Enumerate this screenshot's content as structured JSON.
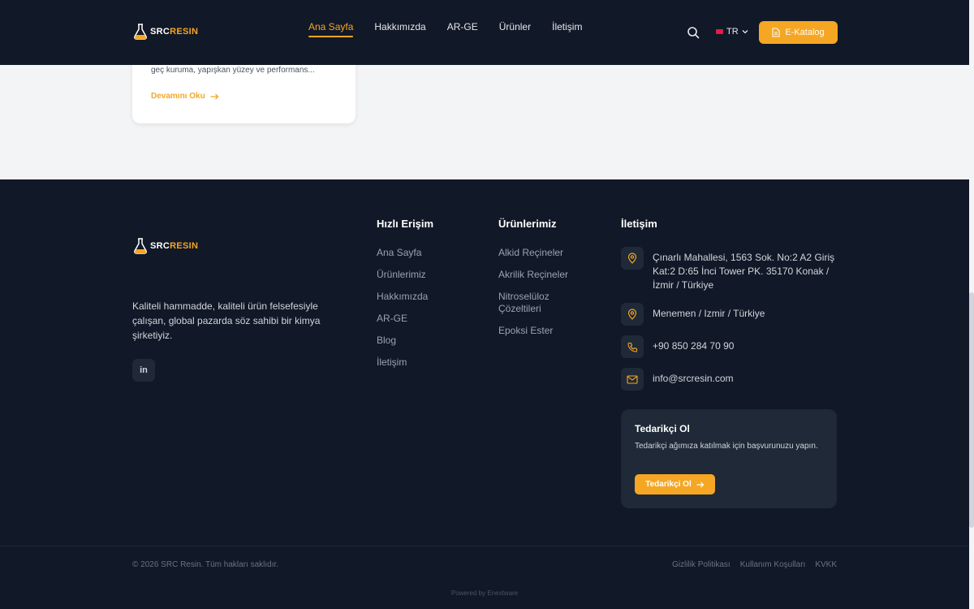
{
  "brand": {
    "name_part1": "SRC",
    "name_part2": "RESIN",
    "accent_color": "#f5a623",
    "background": "#111827"
  },
  "header": {
    "nav": [
      {
        "label": "Ana Sayfa",
        "active": true
      },
      {
        "label": "Hakkımızda"
      },
      {
        "label": "AR-GE"
      },
      {
        "label": "Ürünler"
      },
      {
        "label": "İletişim"
      }
    ],
    "language": "TR",
    "catalog_label": "E-Katalog"
  },
  "blog_card": {
    "excerpt": "geç kuruma, yapışkan yüzey ve performans...",
    "read_more": "Devamını Oku"
  },
  "footer": {
    "about": "Kaliteli hammadde, kaliteli ürün felsefesiyle çalışan, global pazarda söz sahibi bir kimya şirketiyiz.",
    "social_label": "in",
    "quick_access": {
      "title": "Hızlı Erişim",
      "links": [
        "Ana Sayfa",
        "Ürünlerimiz",
        "Hakkımızda",
        "AR-GE",
        "Blog",
        "İletişim"
      ]
    },
    "products": {
      "title": "Ürünlerimiz",
      "links": [
        "Alkid Reçineler",
        "Akrilik Reçineler",
        "Nitroselüloz Çözeltileri",
        "Epoksi Ester"
      ]
    },
    "contact": {
      "title": "İletişim",
      "address": "Çınarlı Mahallesi, 1563 Sok. No:2 A2 Giriş Kat:2 D:65 İnci Tower PK. 35170 Konak / İzmir / Türkiye",
      "address2": "Menemen / Izmir / Türkiye",
      "phone": "+90 850 284 70 90",
      "email": "info@srcresin.com"
    },
    "supplier": {
      "title": "Tedarikçi Ol",
      "description": "Tedarikçi ağımıza katılmak için başvurunuzu yapın.",
      "button": "Tedarikçi Ol"
    },
    "copyright": "© 2026 SRC Resin. Tüm hakları saklıdır.",
    "legal": [
      "Gizlilik Politikası",
      "Kullanım Koşulları",
      "KVKK"
    ],
    "powered_by": "Powered by Enextware"
  }
}
